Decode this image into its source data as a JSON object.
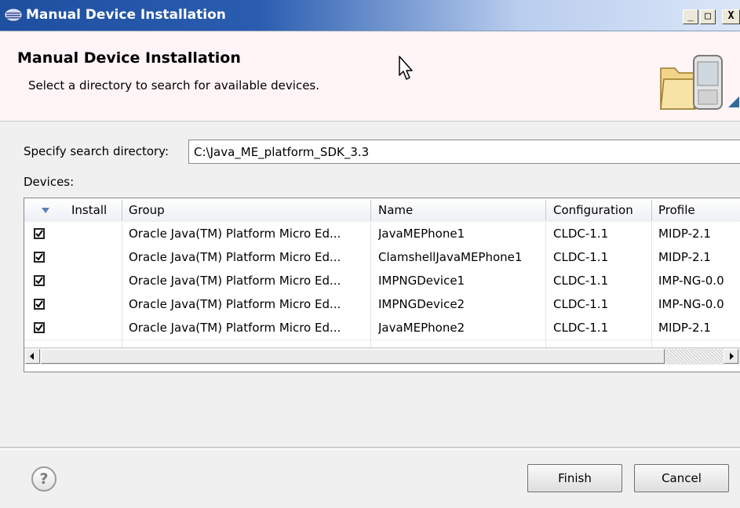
{
  "window": {
    "title": "Manual Device Installation",
    "minimize_glyph": "_",
    "maximize_glyph": "□",
    "close_glyph": "X"
  },
  "header": {
    "title": "Manual Device Installation",
    "description": "Select a directory to search for available devices."
  },
  "search": {
    "label": "Specify search directory:",
    "value": "C:\\Java_ME_platform_SDK_3.3"
  },
  "devices": {
    "label": "Devices:",
    "columns": {
      "install": "Install",
      "group": "Group",
      "name": "Name",
      "configuration": "Configuration",
      "profile": "Profile"
    },
    "rows": [
      {
        "checked": true,
        "group": "Oracle Java(TM) Platform Micro Ed...",
        "name": "JavaMEPhone1",
        "configuration": "CLDC-1.1",
        "profile": "MIDP-2.1"
      },
      {
        "checked": true,
        "group": "Oracle Java(TM) Platform Micro Ed...",
        "name": "ClamshellJavaMEPhone1",
        "configuration": "CLDC-1.1",
        "profile": "MIDP-2.1"
      },
      {
        "checked": true,
        "group": "Oracle Java(TM) Platform Micro Ed...",
        "name": "IMPNGDevice1",
        "configuration": "CLDC-1.1",
        "profile": "IMP-NG-0.0"
      },
      {
        "checked": true,
        "group": "Oracle Java(TM) Platform Micro Ed...",
        "name": "IMPNGDevice2",
        "configuration": "CLDC-1.1",
        "profile": "IMP-NG-0.0"
      },
      {
        "checked": true,
        "group": "Oracle Java(TM) Platform Micro Ed...",
        "name": "JavaMEPhone2",
        "configuration": "CLDC-1.1",
        "profile": "MIDP-2.1"
      }
    ]
  },
  "footer": {
    "help_glyph": "?",
    "finish_label": "Finish",
    "cancel_label": "Cancel"
  },
  "icons": {
    "window": "eclipse-icon",
    "header": "folder-device-icon",
    "cursor": "mouse-pointer-icon",
    "sort": "sort-down-icon"
  }
}
